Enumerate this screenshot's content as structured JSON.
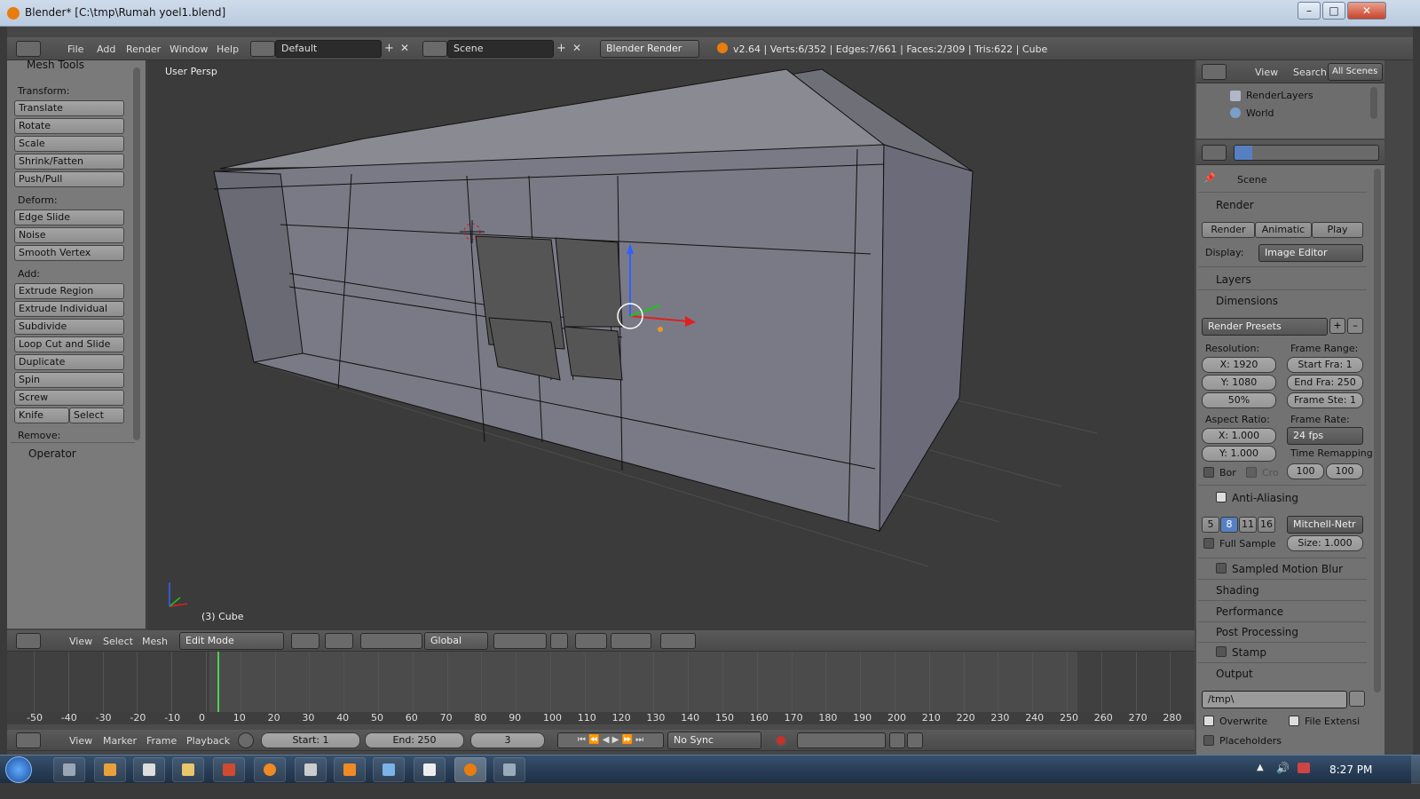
{
  "window": {
    "title": "Blender* [C:\\tmp\\Rumah yoel1.blend]"
  },
  "top_menu": {
    "items": [
      "File",
      "Add",
      "Render",
      "Window",
      "Help"
    ],
    "layout": "Default",
    "scene": "Scene",
    "engine": "Blender Render",
    "stats": "v2.64 | Verts:6/352 | Edges:7/661 | Faces:2/309 | Tris:622 | Cube"
  },
  "toolshelf": {
    "title": "Mesh Tools",
    "transform_label": "Transform:",
    "transform": [
      "Translate",
      "Rotate",
      "Scale",
      "Shrink/Fatten",
      "Push/Pull"
    ],
    "deform_label": "Deform:",
    "deform": [
      "Edge Slide",
      "Noise",
      "Smooth Vertex"
    ],
    "add_label": "Add:",
    "add": [
      "Extrude Region",
      "Extrude Individual",
      "Subdivide",
      "Loop Cut and Slide",
      "Duplicate",
      "Spin",
      "Screw"
    ],
    "knife": "Knife",
    "select": "Select",
    "remove_label": "Remove:",
    "operator": "Operator"
  },
  "viewport": {
    "view_label": "User Persp",
    "object_label": "(3) Cube"
  },
  "view3d_header": {
    "menus": [
      "View",
      "Select",
      "Mesh"
    ],
    "mode": "Edit Mode",
    "orientation": "Global"
  },
  "outliner": {
    "menus": [
      "View",
      "Search"
    ],
    "filter": "All Scenes",
    "items": [
      "RenderLayers",
      "World"
    ]
  },
  "properties": {
    "scene": "Scene",
    "render_panel": "Render",
    "render_btn": "Render",
    "anim_btn": "Animatic",
    "play_btn": "Play",
    "display_label": "Display:",
    "display_value": "Image Editor",
    "layers": "Layers",
    "dimensions": "Dimensions",
    "presets": "Render Presets",
    "resolution_label": "Resolution:",
    "res_x": "X: 1920",
    "res_y": "Y: 1080",
    "res_pct": "50%",
    "frame_range_label": "Frame Range:",
    "start": "Start Fra: 1",
    "end": "End Fra: 250",
    "step": "Frame Ste: 1",
    "aspect_label": "Aspect Ratio:",
    "asp_x": "X: 1.000",
    "asp_y": "Y: 1.000",
    "fps_label": "Frame Rate:",
    "fps": "24 fps",
    "bor": "Bor",
    "cro": "Cro",
    "remap_label": "Time Remapping",
    "remap_old": "100",
    "remap_new": "100",
    "aa": "Anti-Aliasing",
    "aa_samples": [
      "5",
      "8",
      "11",
      "16"
    ],
    "aa_filter": "Mitchell-Netr",
    "full_sample": "Full Sample",
    "size": "Size: 1.000",
    "motion_blur": "Sampled Motion Blur",
    "shading": "Shading",
    "performance": "Performance",
    "post": "Post Processing",
    "stamp": "Stamp",
    "output": "Output",
    "path": "/tmp\\",
    "overwrite": "Overwrite",
    "file_ext": "File Extensi",
    "placeholders": "Placeholders"
  },
  "timeline": {
    "ticks": [
      "-50",
      "-40",
      "-30",
      "-20",
      "-10",
      "0",
      "10",
      "20",
      "30",
      "40",
      "50",
      "60",
      "70",
      "80",
      "90",
      "100",
      "110",
      "120",
      "130",
      "140",
      "150",
      "160",
      "170",
      "180",
      "190",
      "200",
      "210",
      "220",
      "230",
      "240",
      "250",
      "260",
      "270",
      "280"
    ],
    "menus": [
      "View",
      "Marker",
      "Frame",
      "Playback"
    ],
    "start": "Start: 1",
    "end": "End: 250",
    "current": "3",
    "sync": "No Sync"
  },
  "taskbar": {
    "clock": "8:27 PM"
  },
  "colors": {
    "accent": "#5680c2",
    "bg": "#3b3b3b",
    "panel": "#727272"
  }
}
